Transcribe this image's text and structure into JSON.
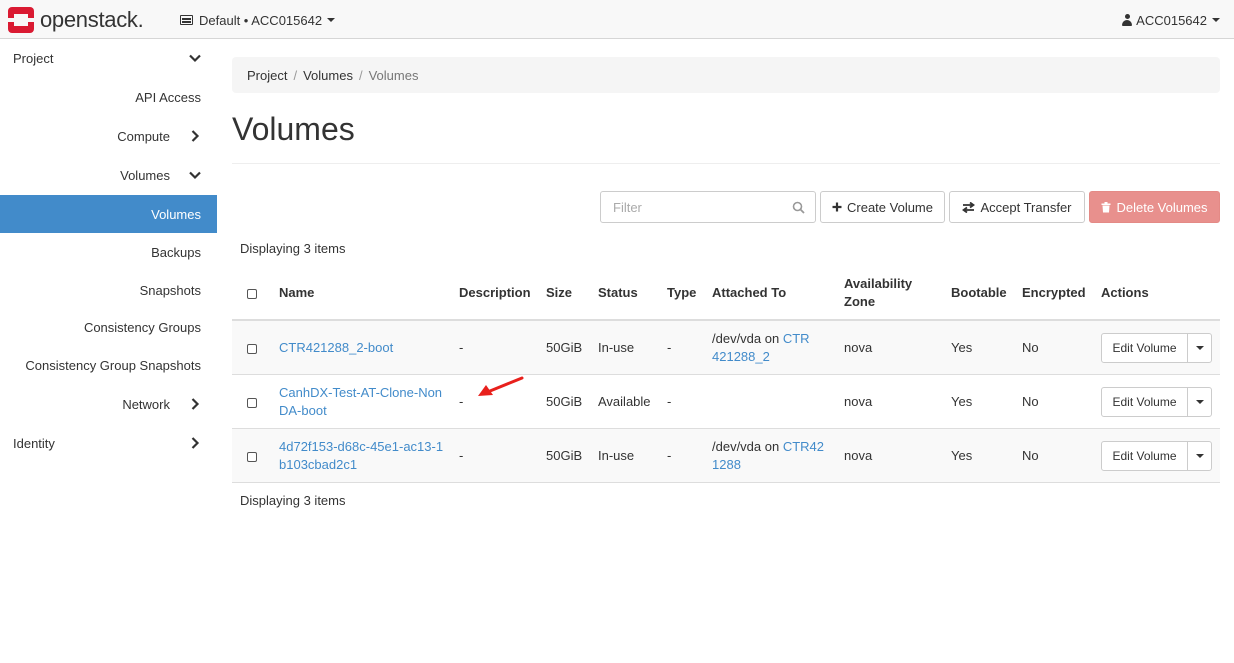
{
  "navbar": {
    "brand": "openstack.",
    "project_selector": "Default • ACC015642",
    "user": "ACC015642"
  },
  "sidebar": {
    "items": [
      {
        "label": "Project",
        "icon": "chevron-down-icon"
      },
      {
        "label": "API Access"
      },
      {
        "label": "Compute",
        "icon": "chevron-right-icon"
      },
      {
        "label": "Volumes",
        "icon": "chevron-down-icon"
      },
      {
        "label": "Volumes",
        "active": true
      },
      {
        "label": "Backups"
      },
      {
        "label": "Snapshots"
      },
      {
        "label": "Consistency Groups"
      },
      {
        "label": "Consistency Group Snapshots"
      },
      {
        "label": "Network",
        "icon": "chevron-right-icon"
      },
      {
        "label": "Identity",
        "icon": "chevron-right-icon"
      }
    ]
  },
  "breadcrumb": [
    "Project",
    "Volumes",
    "Volumes"
  ],
  "page_title": "Volumes",
  "toolbar": {
    "filter_placeholder": "Filter",
    "create_label": "Create Volume",
    "accept_label": "Accept Transfer",
    "delete_label": "Delete Volumes"
  },
  "count_text": "Displaying 3 items",
  "table": {
    "headers": {
      "name": "Name",
      "description": "Description",
      "size": "Size",
      "status": "Status",
      "type": "Type",
      "attached_to": "Attached To",
      "availability_zone_1": "Availability",
      "availability_zone_2": "Zone",
      "bootable": "Bootable",
      "encrypted": "Encrypted",
      "actions": "Actions"
    },
    "rows": [
      {
        "name_1": "CTR421288_2-boot",
        "name_2": "",
        "description": "-",
        "size": "50GiB",
        "status": "In-use",
        "type": "-",
        "attached_prefix": "/dev/vda on ",
        "attached_link_1": "CTR",
        "attached_link_2": "421288_2",
        "zone": "nova",
        "bootable": "Yes",
        "encrypted": "No",
        "action": "Edit Volume"
      },
      {
        "name_1": "CanhDX-Test-AT-Clone-Non",
        "name_2": "DA-boot",
        "description": "-",
        "size": "50GiB",
        "status": "Available",
        "type": "-",
        "attached_prefix": "",
        "attached_link_1": "",
        "attached_link_2": "",
        "zone": "nova",
        "bootable": "Yes",
        "encrypted": "No",
        "action": "Edit Volume"
      },
      {
        "name_1": "4d72f153-d68c-45e1-ac13-1",
        "name_2": "b103cbad2c1",
        "description": "-",
        "size": "50GiB",
        "status": "In-use",
        "type": "-",
        "attached_prefix": "/dev/vda on ",
        "attached_link_1": "CTR42",
        "attached_link_2": "1288",
        "zone": "nova",
        "bootable": "Yes",
        "encrypted": "No",
        "action": "Edit Volume"
      }
    ]
  },
  "colors": {
    "primary": "#428bca",
    "danger_disabled": "#e8908d",
    "annotation_arrow": "#e8201c",
    "brand_red": "#da1a32"
  }
}
